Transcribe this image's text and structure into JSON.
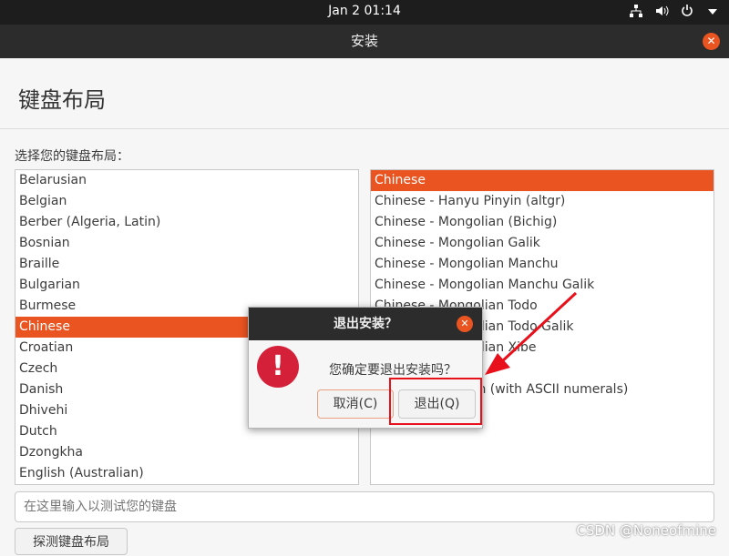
{
  "topbar": {
    "clock": "Jan 2  01:14",
    "icons": [
      "network-icon",
      "volume-icon",
      "power-icon",
      "menu-arrow-icon"
    ]
  },
  "window": {
    "title": "安装"
  },
  "page": {
    "title": "键盘布局",
    "prompt": "选择您的键盘布局：",
    "search_placeholder": "在这里输入以测试您的键盘",
    "detect_label": "探测键盘布局"
  },
  "layouts": [
    "Belarusian",
    "Belgian",
    "Berber (Algeria, Latin)",
    "Bosnian",
    "Braille",
    "Bulgarian",
    "Burmese",
    "Chinese",
    "Croatian",
    "Czech",
    "Danish",
    "Dhivehi",
    "Dutch",
    "Dzongkha",
    "English (Australian)"
  ],
  "layouts_selected": "Chinese",
  "variants": [
    "Chinese",
    "Chinese - Hanyu Pinyin (altgr)",
    "Chinese - Mongolian (Bichig)",
    "Chinese - Mongolian Galik",
    "Chinese - Mongolian Manchu",
    "Chinese - Mongolian Manchu Galik",
    "Chinese - Mongolian Todo",
    "Chinese - Mongolian Todo Galik",
    "Chinese - Mongolian Xibe",
    "",
    "Chinese - Tibetan (with ASCII numerals)"
  ],
  "variants_selected": "Chinese",
  "dialog": {
    "title": "退出安装？",
    "message": "您确定要退出安装吗？",
    "cancel": "取消(C)",
    "quit": "退出(Q)"
  },
  "colors": {
    "accent": "#e95420",
    "annotation": "#e8101a"
  },
  "watermark": "CSDN @Noneofmine"
}
